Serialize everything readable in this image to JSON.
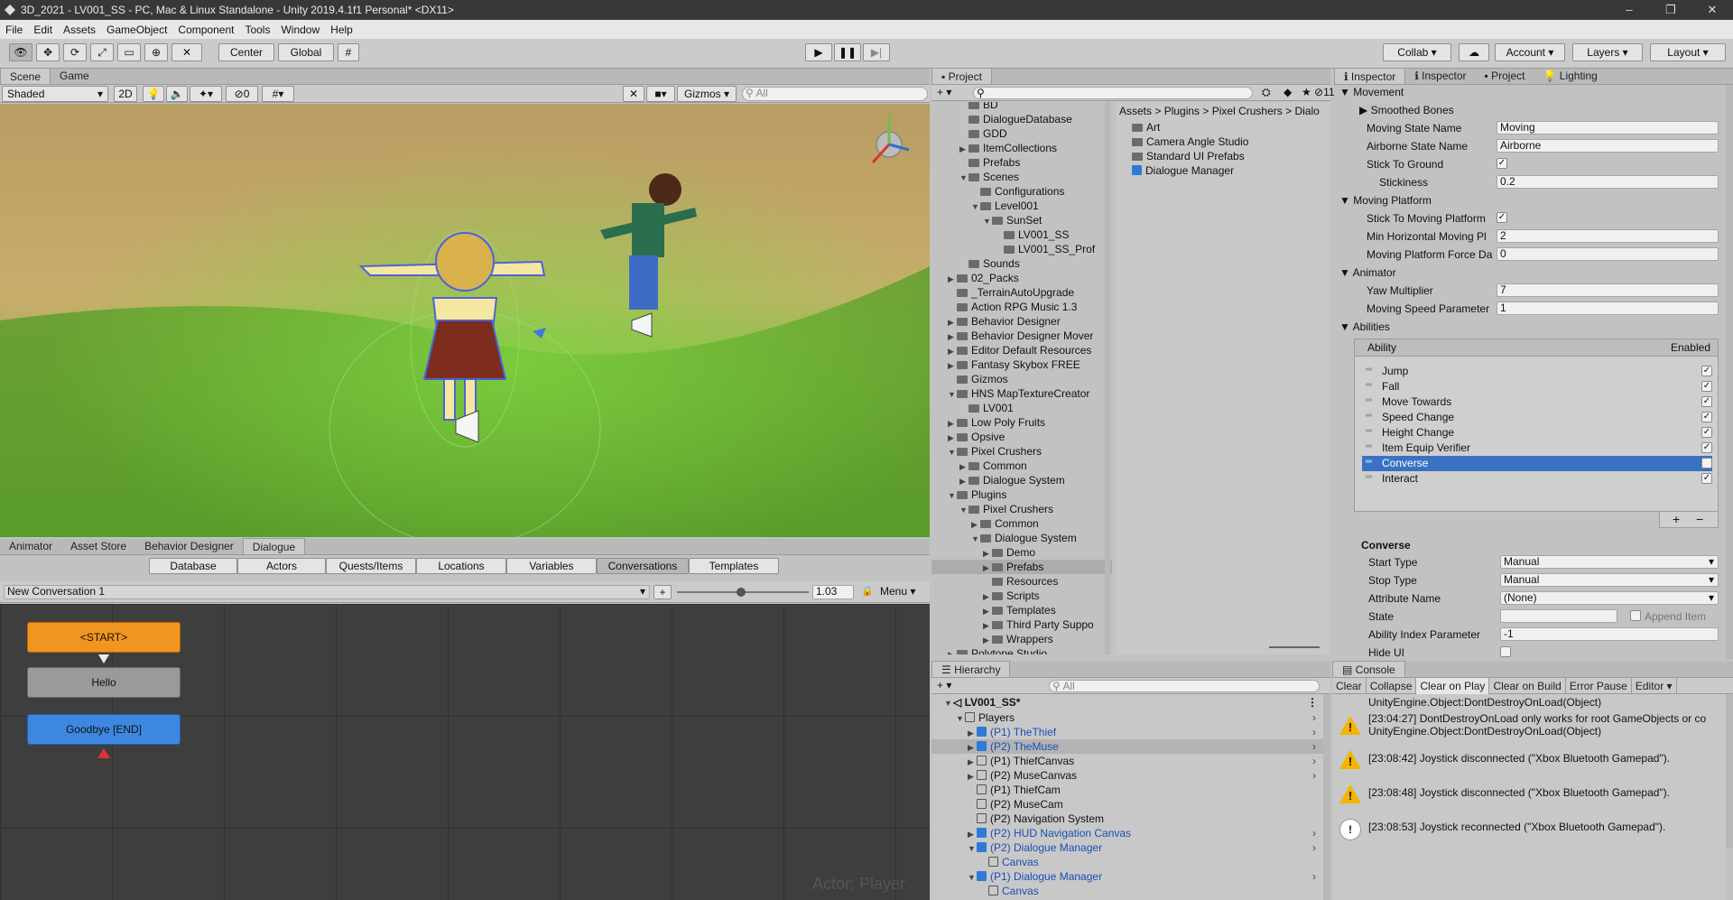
{
  "window": {
    "title": "3D_2021 - LV001_SS - PC, Mac & Linux Standalone - Unity 2019.4.1f1 Personal* <DX11>"
  },
  "menu": [
    "File",
    "Edit",
    "Assets",
    "GameObject",
    "Component",
    "Tools",
    "Window",
    "Help"
  ],
  "toolbar": {
    "pivot": "Center",
    "space": "Global",
    "collab": "Collab",
    "account": "Account",
    "layers": "Layers",
    "layout": "Layout"
  },
  "scene": {
    "tabs": [
      "Scene",
      "Game"
    ],
    "shading": "Shaded",
    "mode2d": "2D",
    "hidden_count": "0",
    "gizmos": "Gizmos",
    "search_placeholder": "All"
  },
  "dialogue_panel": {
    "tabs": [
      "Animator",
      "Asset Store",
      "Behavior Designer",
      "Dialogue"
    ],
    "subtabs": [
      "Database",
      "Actors",
      "Quests/Items",
      "Locations",
      "Variables",
      "Conversations",
      "Templates"
    ],
    "active_subtab": "Conversations",
    "conversation": "New Conversation 1",
    "plus": "+",
    "zoom": "1.03",
    "menu": "Menu",
    "nodes": [
      "<START>",
      "Hello",
      "Goodbye [END]"
    ],
    "watermark": "Actor: Player"
  },
  "project": {
    "tab": "Project",
    "search_placeholder": "",
    "hidden_count": "11",
    "tree": [
      {
        "label": "BD",
        "depth": 3,
        "arrow": ""
      },
      {
        "label": "DialogueDatabase",
        "depth": 3,
        "arrow": ""
      },
      {
        "label": "GDD",
        "depth": 3,
        "arrow": ""
      },
      {
        "label": "ItemCollections",
        "depth": 3,
        "arrow": "▶"
      },
      {
        "label": "Prefabs",
        "depth": 3,
        "arrow": ""
      },
      {
        "label": "Scenes",
        "depth": 3,
        "arrow": "▼"
      },
      {
        "label": "Configurations",
        "depth": 4,
        "arrow": ""
      },
      {
        "label": "Level001",
        "depth": 4,
        "arrow": "▼"
      },
      {
        "label": "SunSet",
        "depth": 5,
        "arrow": "▼"
      },
      {
        "label": "LV001_SS",
        "depth": 6,
        "arrow": ""
      },
      {
        "label": "LV001_SS_Prof",
        "depth": 6,
        "arrow": ""
      },
      {
        "label": "Sounds",
        "depth": 3,
        "arrow": ""
      },
      {
        "label": "02_Packs",
        "depth": 2,
        "arrow": "▶"
      },
      {
        "label": "_TerrainAutoUpgrade",
        "depth": 2,
        "arrow": ""
      },
      {
        "label": "Action RPG Music 1.3",
        "depth": 2,
        "arrow": ""
      },
      {
        "label": "Behavior Designer",
        "depth": 2,
        "arrow": "▶"
      },
      {
        "label": "Behavior Designer Mover",
        "depth": 2,
        "arrow": "▶"
      },
      {
        "label": "Editor Default Resources",
        "depth": 2,
        "arrow": "▶"
      },
      {
        "label": "Fantasy Skybox FREE",
        "depth": 2,
        "arrow": "▶"
      },
      {
        "label": "Gizmos",
        "depth": 2,
        "arrow": ""
      },
      {
        "label": "HNS MapTextureCreator",
        "depth": 2,
        "arrow": "▼"
      },
      {
        "label": "LV001",
        "depth": 3,
        "arrow": ""
      },
      {
        "label": "Low Poly Fruits",
        "depth": 2,
        "arrow": "▶"
      },
      {
        "label": "Opsive",
        "depth": 2,
        "arrow": "▶"
      },
      {
        "label": "Pixel Crushers",
        "depth": 2,
        "arrow": "▼"
      },
      {
        "label": "Common",
        "depth": 3,
        "arrow": "▶"
      },
      {
        "label": "Dialogue System",
        "depth": 3,
        "arrow": "▶"
      },
      {
        "label": "Plugins",
        "depth": 2,
        "arrow": "▼"
      },
      {
        "label": "Pixel Crushers",
        "depth": 3,
        "arrow": "▼"
      },
      {
        "label": "Common",
        "depth": 4,
        "arrow": "▶"
      },
      {
        "label": "Dialogue System",
        "depth": 4,
        "arrow": "▼"
      },
      {
        "label": "Demo",
        "depth": 5,
        "arrow": "▶"
      },
      {
        "label": "Prefabs",
        "depth": 5,
        "arrow": "▶"
      },
      {
        "label": "Resources",
        "depth": 5,
        "arrow": ""
      },
      {
        "label": "Scripts",
        "depth": 5,
        "arrow": "▶"
      },
      {
        "label": "Templates",
        "depth": 5,
        "arrow": "▶"
      },
      {
        "label": "Third Party Suppo",
        "depth": 5,
        "arrow": "▶"
      },
      {
        "label": "Wrappers",
        "depth": 5,
        "arrow": "▶"
      },
      {
        "label": "Polytope Studio",
        "depth": 2,
        "arrow": "▶"
      }
    ],
    "selected": "Prefabs",
    "breadcrumb": [
      "Assets",
      "Plugins",
      "Pixel Crushers",
      "Dialo"
    ],
    "assets": [
      {
        "label": "Art",
        "type": "folder"
      },
      {
        "label": "Camera Angle Studio",
        "type": "folder"
      },
      {
        "label": "Standard UI Prefabs",
        "type": "folder"
      },
      {
        "label": "Dialogue Manager",
        "type": "prefab"
      }
    ]
  },
  "hierarchy": {
    "tab": "Hierarchy",
    "search_placeholder": "All",
    "scene": "LV001_SS*",
    "items": [
      {
        "label": "Players",
        "depth": 1,
        "arrow": "▼",
        "kind": "grey",
        "color": "#111"
      },
      {
        "label": "(P1) TheThief",
        "depth": 2,
        "arrow": "▶",
        "kind": "blue",
        "color": "#1a4fb5"
      },
      {
        "label": "(P2) TheMuse",
        "depth": 2,
        "arrow": "▶",
        "kind": "blue",
        "color": "#1a4fb5"
      },
      {
        "label": "(P1) ThiefCanvas",
        "depth": 2,
        "arrow": "▶",
        "kind": "grey",
        "color": "#111"
      },
      {
        "label": "(P2) MuseCanvas",
        "depth": 2,
        "arrow": "▶",
        "kind": "grey",
        "color": "#111"
      },
      {
        "label": "(P1) ThiefCam",
        "depth": 2,
        "arrow": "",
        "kind": "grey",
        "color": "#111"
      },
      {
        "label": "(P2) MuseCam",
        "depth": 2,
        "arrow": "",
        "kind": "grey",
        "color": "#111"
      },
      {
        "label": "(P2) Navigation System",
        "depth": 2,
        "arrow": "",
        "kind": "grey",
        "color": "#111"
      },
      {
        "label": "(P2) HUD Navigation Canvas",
        "depth": 2,
        "arrow": "▶",
        "kind": "blue",
        "color": "#1a4fb5"
      },
      {
        "label": "(P2) Dialogue Manager",
        "depth": 2,
        "arrow": "▼",
        "kind": "blue",
        "color": "#1a4fb5"
      },
      {
        "label": "Canvas",
        "depth": 3,
        "arrow": "",
        "kind": "grey",
        "color": "#1a4fb5"
      },
      {
        "label": "(P1) Dialogue Manager",
        "depth": 2,
        "arrow": "▼",
        "kind": "blue",
        "color": "#1a4fb5"
      },
      {
        "label": "Canvas",
        "depth": 3,
        "arrow": "",
        "kind": "grey",
        "color": "#1a4fb5"
      }
    ]
  },
  "inspector": {
    "tabs": [
      "Inspector",
      "Inspector",
      "Project",
      "Lighting"
    ],
    "sections": {
      "movement": "Movement",
      "moving_platform": "Moving Platform",
      "animator": "Animator",
      "abilities": "Abilities",
      "converse": "Converse"
    },
    "smoothed_bones": "Smoothed Bones",
    "fields": [
      {
        "label": "Moving State Name",
        "value": "Moving"
      },
      {
        "label": "Airborne State Name",
        "value": "Airborne"
      },
      {
        "label": "Stick To Ground",
        "value": "✓"
      },
      {
        "label": "Stickiness",
        "value": "0.2"
      },
      {
        "label": "Stick To Moving Platform",
        "value": "✓"
      },
      {
        "label": "Min Horizontal Moving Pl",
        "value": "2"
      },
      {
        "label": "Moving Platform Force Da",
        "value": "0"
      },
      {
        "label": "Yaw Multiplier",
        "value": "7"
      },
      {
        "label": "Moving Speed Parameter",
        "value": "1"
      }
    ],
    "abilities_header": {
      "name": "Ability",
      "enabled": "Enabled"
    },
    "abilities": [
      {
        "name": "Jump",
        "enabled": "✓"
      },
      {
        "name": "Fall",
        "enabled": "✓"
      },
      {
        "name": "Move Towards",
        "enabled": "✓"
      },
      {
        "name": "Speed Change",
        "enabled": "✓"
      },
      {
        "name": "Height Change",
        "enabled": "✓"
      },
      {
        "name": "Item Equip Verifier",
        "enabled": "✓"
      },
      {
        "name": "Converse",
        "enabled": "✓"
      },
      {
        "name": "Interact",
        "enabled": "✓"
      }
    ],
    "selected_ability": "Converse",
    "list_buttons": {
      "add": "+",
      "remove": "−"
    },
    "converse_fields": [
      {
        "label": "Start Type",
        "value": "Manual"
      },
      {
        "label": "Stop Type",
        "value": "Manual"
      },
      {
        "label": "Attribute Name",
        "value": "(None)"
      },
      {
        "label": "State",
        "value": ""
      },
      {
        "label": "Ability Index Parameter",
        "value": "-1"
      },
      {
        "label": "Hide UI",
        "value": ""
      }
    ],
    "append_item": "Append Item"
  },
  "console": {
    "tab": "Console",
    "buttons": [
      "Clear",
      "Collapse",
      "Clear on Play",
      "Clear on Build",
      "Error Pause",
      "Editor"
    ],
    "entries": [
      {
        "text": "UnityEngine.Object:DontDestroyOnLoad(Object)",
        "icon": ""
      },
      {
        "text": "[23:04:27] DontDestroyOnLoad only works for root GameObjects or co",
        "text2": "UnityEngine.Object:DontDestroyOnLoad(Object)",
        "icon": "warning"
      },
      {
        "text": "[23:08:42] Joystick disconnected (\"Xbox Bluetooth Gamepad\").",
        "icon": "warning"
      },
      {
        "text": "[23:08:48] Joystick disconnected (\"Xbox Bluetooth Gamepad\").",
        "icon": "warning"
      },
      {
        "text": "[23:08:53] Joystick reconnected (\"Xbox Bluetooth Gamepad\").",
        "icon": "info"
      }
    ]
  }
}
